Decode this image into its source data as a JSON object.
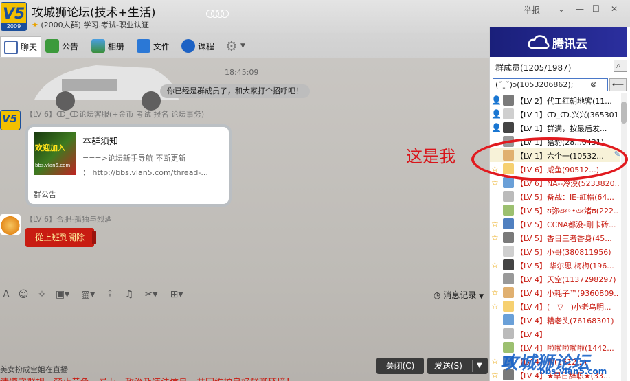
{
  "window": {
    "group_name": "攻城狮论坛(技术+生活)",
    "group_info": "(2000人群) 学习.考试-职业认证",
    "logo_text": "V5",
    "logo_year": "2009",
    "report_label": "举报"
  },
  "toolbar": {
    "tabs": [
      {
        "label": "聊天",
        "icon": "chat-icon"
      },
      {
        "label": "公告",
        "icon": "flag-icon"
      },
      {
        "label": "相册",
        "icon": "photo-icon"
      },
      {
        "label": "文件",
        "icon": "folder-icon"
      },
      {
        "label": "课程",
        "icon": "play-icon"
      }
    ]
  },
  "chat": {
    "time": "18:45:09",
    "system_message": "你已经是群成员了，和大家打个招呼吧！",
    "messages": [
      {
        "sender": "【LV 6】ↀ_ↀ论坛客服(+金币 考试 报名 论坛事务)",
        "card": {
          "image_text": "欢迎加入",
          "image_sub": "bbs.vlan5.com",
          "title": "本群须知",
          "line1": "===>论坛新手导航 不断更新",
          "line2": "：  http://bbs.vlan5.com/thread-...",
          "footer": "群公告"
        }
      },
      {
        "sender": "【LV 6】合肥-孤独与烈酒",
        "button_text": "從上班到開除"
      }
    ]
  },
  "input_toolbar": {
    "message_record": "消息记录"
  },
  "footer": {
    "live_text": "美女扮成空姐在直播",
    "bottom_text": "请遵守群规，禁止黄色、暴力、政治及违法信息，共同维护良好群聊环境！",
    "close_label": "关闭(C)",
    "send_label": "发送(S)"
  },
  "right_panel": {
    "banner_text": "腾讯云",
    "members_title": "群成员(1205/1987)",
    "search_value": "(ˇˍˇ)ↄ(1053206862);"
  },
  "members": [
    {
      "name": "【LV 2】代工紅朝地客(11...",
      "color": "#111111",
      "role": "owner"
    },
    {
      "name": "【LV 1】ↀ_ↀ.兴兴(365301...",
      "color": "#111111",
      "role": "owner"
    },
    {
      "name": "【LV 1】群满，按最后发...",
      "color": "#111111",
      "role": "owner"
    },
    {
      "name": "【LV 1】猎豹(28...0431)",
      "color": "#111111",
      "role": "none"
    },
    {
      "name": "【LV 1】六个一(10532...",
      "color": "#111111",
      "role": "none",
      "selected": true
    },
    {
      "name": "【LV 6】咸鱼(90512...)",
      "color": "#c81c12",
      "role": "admin"
    },
    {
      "name": "【LV 6】NA--冷漠(5233820...",
      "color": "#c81c12",
      "role": "admin"
    },
    {
      "name": "【LV 5】备战：IE-紅帽(64...",
      "color": "#c81c12",
      "role": "none"
    },
    {
      "name": "【LV 5】ʊ弥ঞ◦•ঞ渚ʊ(222...",
      "color": "#c81c12",
      "role": "none"
    },
    {
      "name": "【LV 5】CCNA都没-剛卡砖...",
      "color": "#c81c12",
      "role": "admin"
    },
    {
      "name": "【LV 5】香日三者香身(45...",
      "color": "#c81c12",
      "role": "admin"
    },
    {
      "name": "【LV 5】小哥(380811956)",
      "color": "#c81c12",
      "role": "none"
    },
    {
      "name": "【LV 5】 华尔思 梅梅(196...",
      "color": "#c81c12",
      "role": "admin"
    },
    {
      "name": "【LV 4】天空(1137298297)",
      "color": "#c81c12",
      "role": "none"
    },
    {
      "name": "【LV 4】小耗子™(9360809...",
      "color": "#c81c12",
      "role": "admin"
    },
    {
      "name": "【LV 4】(￣▽￣)小老乌明...",
      "color": "#c81c12",
      "role": "admin"
    },
    {
      "name": "【LV 4】糟老头(76168301)",
      "color": "#c81c12",
      "role": "none"
    },
    {
      "name": "【LV 4】",
      "color": "#c81c12",
      "role": "none"
    },
    {
      "name": "【LV 4】啦啦啦啦啦(1442...",
      "color": "#c81c12",
      "role": "none"
    },
    {
      "name": "【LV 4】鵬(1612...)",
      "color": "#c81c12",
      "role": "admin"
    },
    {
      "name": "【LV 4】★早日辞职★(33...",
      "color": "#c81c12",
      "role": "admin"
    }
  ],
  "annotation": {
    "text": "这是我"
  },
  "watermark": {
    "text": "攻城狮论坛",
    "url": "bbs.vlan5.com"
  }
}
